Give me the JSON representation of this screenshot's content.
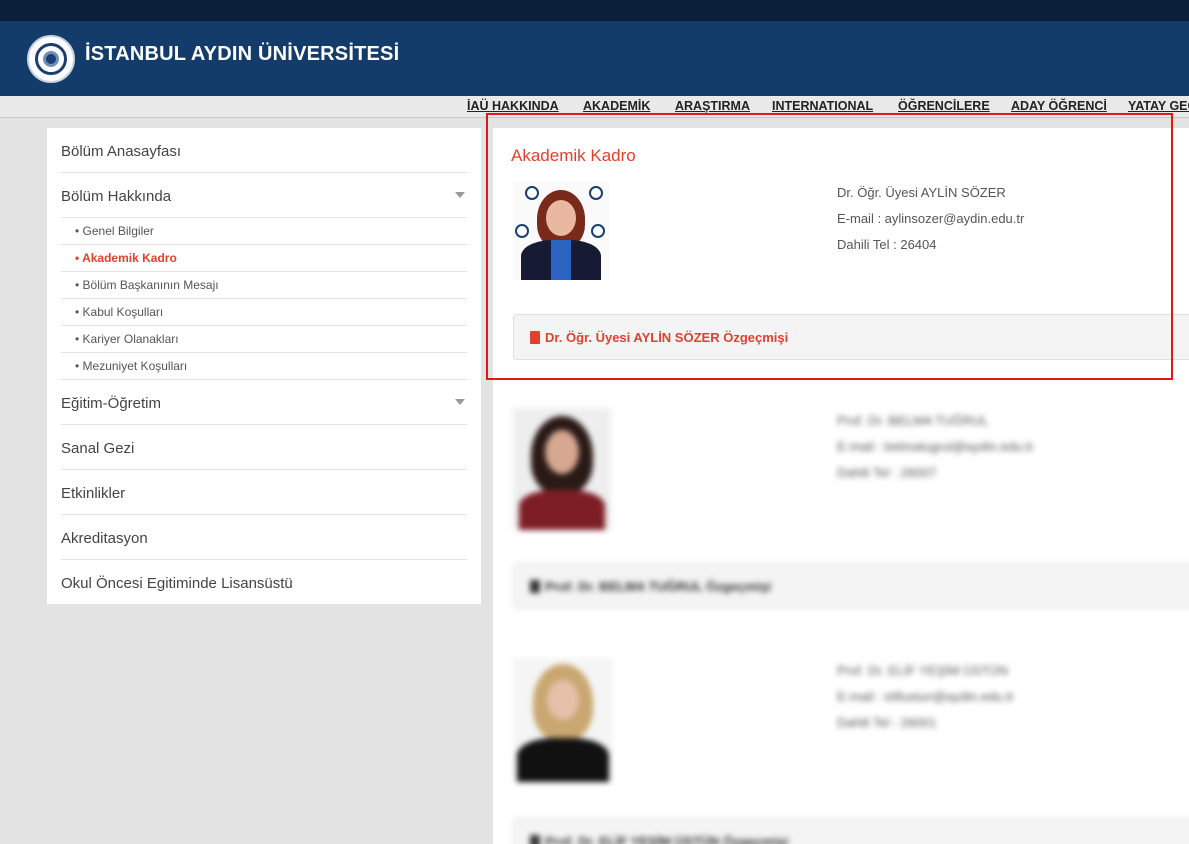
{
  "header": {
    "title": "İSTANBUL AYDIN ÜNİVERSİTESİ",
    "logo_icon": "university-seal-icon"
  },
  "nav": {
    "items": [
      "İAÜ HAKKINDA",
      "AKADEMİK",
      "ARAŞTIRMA",
      "INTERNATIONAL",
      "ÖĞRENCİLERE",
      "ADAY ÖĞRENCİ",
      "YATAY GEÇİŞ"
    ]
  },
  "sidebar": {
    "items": {
      "home": "Bölüm Anasayfası",
      "about": "Bölüm Hakkında",
      "education": "Eğitim-Öğretim",
      "tour": "Sanal Gezi",
      "events": "Etkinlikler",
      "accreditation": "Akreditasyon",
      "graduate": "Okul Öncesi Egitiminde Lisansüstü"
    },
    "about_sub": [
      "• Genel Bilgiler",
      "• Akademik Kadro",
      "• Bölüm Başkanının Mesajı",
      "• Kabul Koşulları",
      "• Kariyer Olanakları",
      "• Mezuniyet Koşulları"
    ],
    "active_sub": "• Akademik Kadro"
  },
  "content": {
    "title": "Akademik Kadro",
    "staff": [
      {
        "name": "Dr. Öğr. Üyesi AYLİN SÖZER",
        "email": "E-mail : aylinsozer@aydin.edu.tr",
        "phone": "Dahili Tel : 26404",
        "cv": "Dr. Öğr. Üyesi AYLİN SÖZER Özgeçmişi"
      },
      {
        "name": "Prof. Dr. BELMA TUĞRUL",
        "email": "E-mail : belmatugrul@aydin.edu.tr",
        "phone": "Dahili Tel : 26007",
        "cv": "Prof. Dr. BELMA TUĞRUL Özgeçmişi"
      },
      {
        "name": "Prof. Dr. ELİF YEŞİM ÜSTÜN",
        "email": "E-mail : elifustun@aydin.edu.tr",
        "phone": "Dahili Tel : 26001",
        "cv": "Prof. Dr. ELİF YEŞİM ÜSTÜN Özgeçmişi"
      }
    ]
  },
  "colors": {
    "accent": "#e0412d",
    "header": "#143c6b",
    "highlight": "#e01818"
  }
}
